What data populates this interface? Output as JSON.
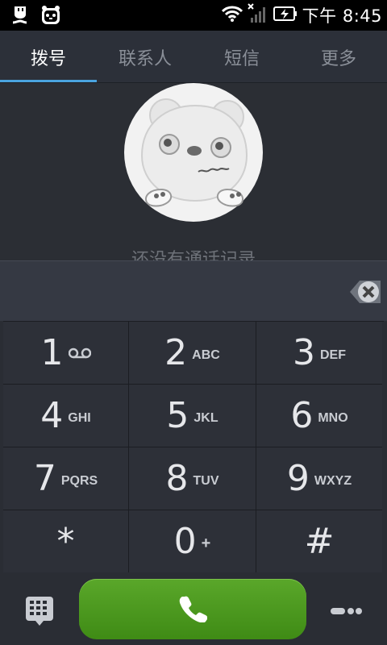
{
  "status_bar": {
    "time": "下午 8:45",
    "icons": [
      "usb-debug-icon",
      "app-mascot-icon",
      "wifi-icon",
      "no-signal-icon",
      "battery-charging-icon"
    ]
  },
  "tabs": [
    {
      "label": "拨号",
      "active": true
    },
    {
      "label": "联系人",
      "active": false
    },
    {
      "label": "短信",
      "active": false
    },
    {
      "label": "更多",
      "active": false
    }
  ],
  "call_log": {
    "empty_message": "还没有通话记录"
  },
  "keypad": {
    "keys": [
      {
        "digit": "1",
        "letters": "",
        "icon": "voicemail-icon"
      },
      {
        "digit": "2",
        "letters": "ABC"
      },
      {
        "digit": "3",
        "letters": "DEF"
      },
      {
        "digit": "4",
        "letters": "GHI"
      },
      {
        "digit": "5",
        "letters": "JKL"
      },
      {
        "digit": "6",
        "letters": "MNO"
      },
      {
        "digit": "7",
        "letters": "PQRS"
      },
      {
        "digit": "8",
        "letters": "TUV"
      },
      {
        "digit": "9",
        "letters": "WXYZ"
      },
      {
        "digit": "*",
        "letters": ""
      },
      {
        "digit": "0",
        "letters": "+"
      },
      {
        "digit": "#",
        "letters": ""
      }
    ]
  },
  "colors": {
    "accent": "#4aa3df",
    "call_green": "#4a9a1f",
    "background": "#2b2e34"
  }
}
